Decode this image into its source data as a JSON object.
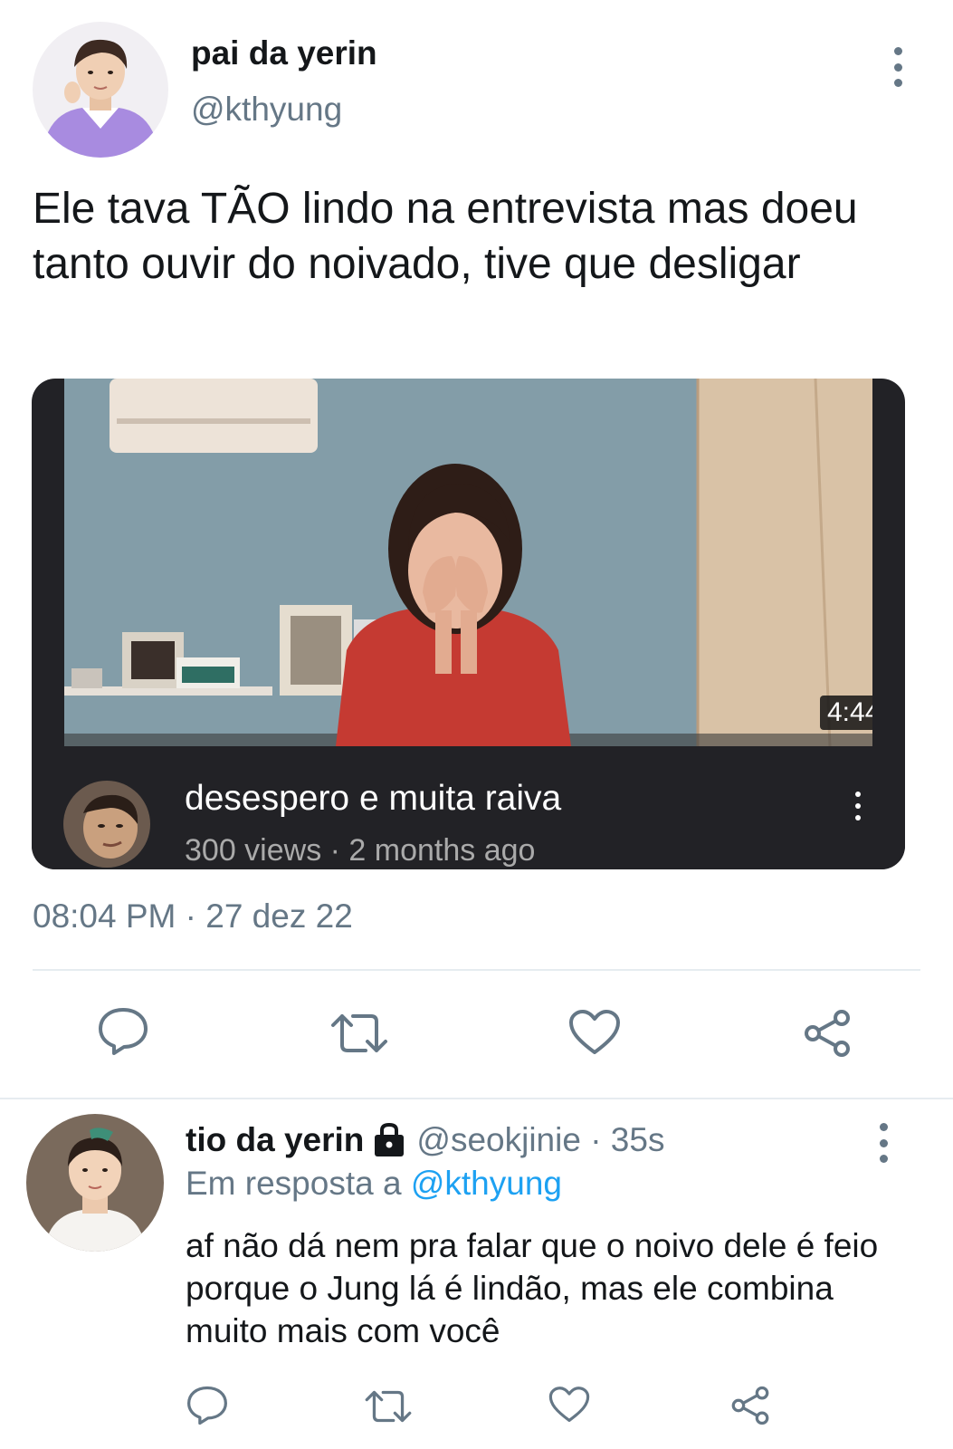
{
  "main_tweet": {
    "display_name": "pai da yerin",
    "handle": "@kthyung",
    "text": "Ele tava TÃO lindo na entrevista mas doeu tanto ouvir do noivado, tive que desligar",
    "timestamp": "08:04 PM · 27 dez 22",
    "video": {
      "duration": "4:44",
      "title": "desespero e muita raiva",
      "meta": "300 views · 2 months ago"
    },
    "actions": [
      "reply-icon",
      "retweet-icon",
      "like-icon",
      "share-icon"
    ]
  },
  "reply_tweet": {
    "display_name": "tio da yerin",
    "handle_time": "@seokjinie · 35s",
    "reply_prefix": "Em resposta a ",
    "reply_mention": "@kthyung",
    "text": "af não dá nem pra falar que o noivo dele é feio porque o Jung lá é lindão, mas ele combina muito mais com você",
    "actions": [
      "reply-icon",
      "retweet-icon",
      "like-icon",
      "share-icon"
    ]
  },
  "colors": {
    "text_primary": "#14171a",
    "text_secondary": "#657786",
    "link": "#1da1f2",
    "divider": "#e6ecf0",
    "video_info_bg": "#222226"
  }
}
